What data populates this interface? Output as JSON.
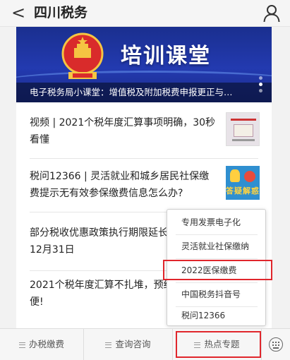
{
  "header": {
    "back_glyph": "<",
    "title": "四川税务",
    "user_icon": "person-icon"
  },
  "banner": {
    "title": "培训课堂",
    "caption": "电子税务局小课堂：增值税及附加税费申报更正与…",
    "slides_total": 3,
    "slides_active": 2
  },
  "articles": [
    {
      "text": "视频 | 2021个税年度汇算事项明确，30秒看懂",
      "thumb": "doc-thumbnail"
    },
    {
      "text": "税问12366 | 灵活就业和城乡居民社保缴费提示无有效参保缴费信息怎么办?",
      "thumb": "qa-thumbnail",
      "thumb_text": "答疑解惑"
    },
    {
      "text": "部分税收优惠政策执行期限延长至2023年12月31日"
    },
    {
      "text": "2021个税年度汇算不扎堆，预约办理更方便!"
    }
  ],
  "popup_menu": {
    "items": [
      "专用发票电子化",
      "灵活就业社保缴纳",
      "2022医保缴费",
      "中国税务抖音号",
      "税问12366"
    ],
    "highlighted": "2022医保缴费"
  },
  "tabbar": {
    "tabs": [
      "办税缴费",
      "查询咨询",
      "热点专题"
    ],
    "active": "热点专题",
    "keyboard_icon": "keyboard-icon"
  },
  "colors": {
    "highlight": "#e0262c",
    "banner": "#1f37a8"
  }
}
